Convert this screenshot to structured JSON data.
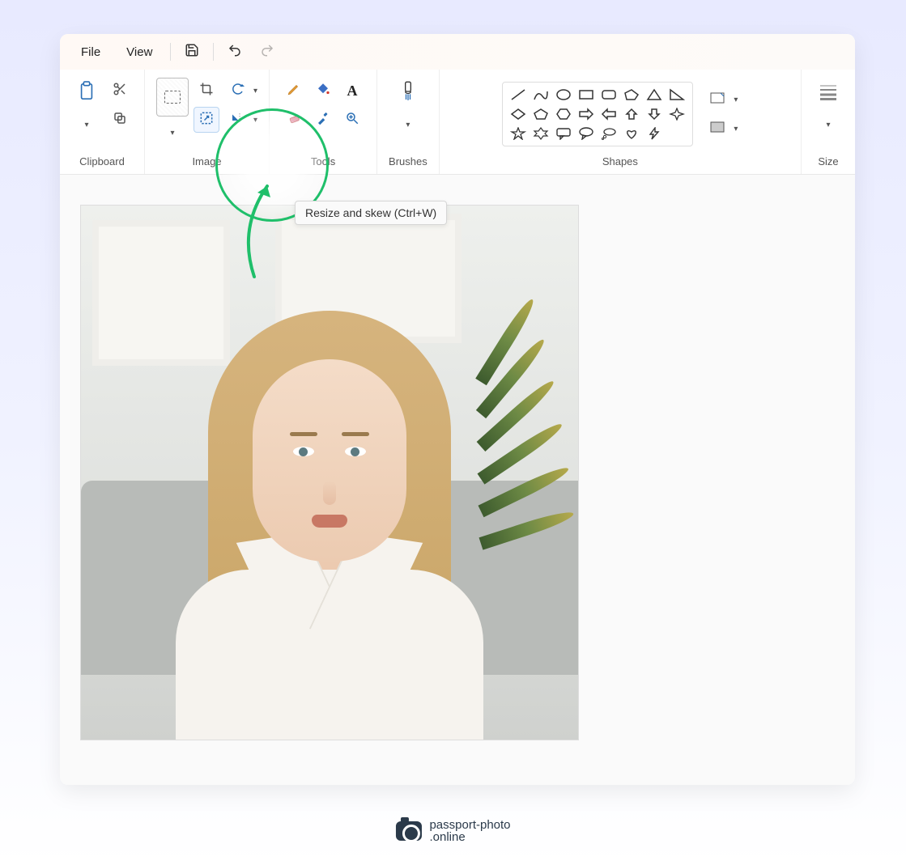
{
  "menubar": {
    "file": "File",
    "view": "View",
    "save_icon": "save-icon",
    "undo_icon": "undo-icon",
    "redo_icon": "redo-icon"
  },
  "ribbon": {
    "clipboard": {
      "label": "Clipboard"
    },
    "image": {
      "label": "Image"
    },
    "tools": {
      "label": "Tools"
    },
    "brushes": {
      "label": "Brushes"
    },
    "shapes": {
      "label": "Shapes"
    },
    "size": {
      "label": "Size"
    }
  },
  "tooltip": {
    "resize_skew": "Resize and skew (Ctrl+W)"
  },
  "shapes_list": [
    "line",
    "curve",
    "oval",
    "rect",
    "round-rect",
    "polygon",
    "triangle",
    "right-triangle",
    "diamond",
    "pentagon",
    "hexagon",
    "arrow-right",
    "arrow-left",
    "arrow-up",
    "arrow-down",
    "four-star",
    "five-star",
    "six-star",
    "speech-rect",
    "speech-oval",
    "thought",
    "heart",
    "lightning"
  ],
  "watermark": {
    "line1": "passport-photo",
    "line2": ".online"
  }
}
